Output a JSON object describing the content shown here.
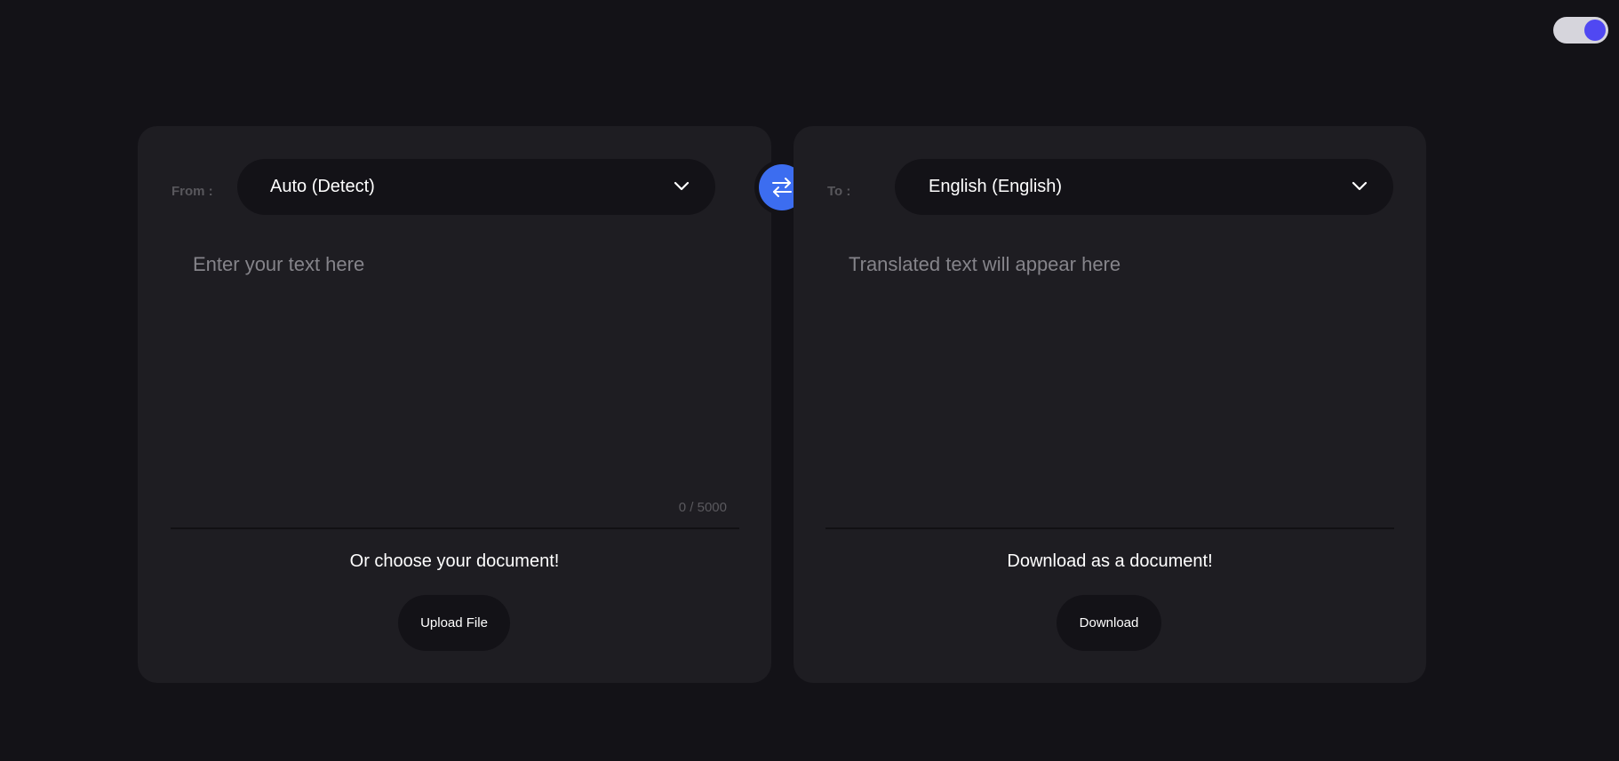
{
  "theme_toggle": {
    "state": "on",
    "knob_color": "#5048f2",
    "track_color": "#d6d5dc"
  },
  "swap": {
    "icon": "swap-arrows-icon",
    "color": "#3c6df0"
  },
  "source": {
    "label": "From :",
    "selected_language": "Auto (Detect)",
    "placeholder": "Enter your text here",
    "char_count": "0 / 5000",
    "doc_caption": "Or choose your document!",
    "button_label": "Upload File"
  },
  "target": {
    "label": "To :",
    "selected_language": "English (English)",
    "placeholder": "Translated text will appear here",
    "doc_caption": "Download as a document!",
    "button_label": "Download"
  },
  "colors": {
    "background": "#131217",
    "panel": "#1e1d22",
    "accent": "#3c6df0"
  }
}
